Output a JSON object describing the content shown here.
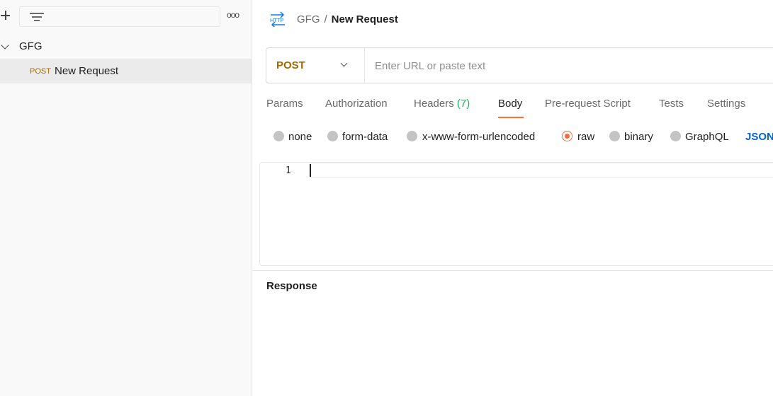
{
  "sidebar": {
    "filter_placeholder": "",
    "collection": {
      "name": "GFG"
    },
    "requests": [
      {
        "method": "POST",
        "name": "New Request"
      }
    ],
    "more_label": "ooo"
  },
  "header": {
    "icon": "http-icon",
    "breadcrumb_parent": "GFG",
    "breadcrumb_separator": "/",
    "breadcrumb_current": "New Request"
  },
  "url_bar": {
    "method": "POST",
    "placeholder": "Enter URL or paste text",
    "value": ""
  },
  "tabs": {
    "params": "Params",
    "authorization": "Authorization",
    "headers": "Headers",
    "headers_count": "(7)",
    "body": "Body",
    "prerequest": "Pre-request Script",
    "tests": "Tests",
    "settings": "Settings",
    "active": "Body"
  },
  "body_types": {
    "none": "none",
    "form_data": "form-data",
    "urlencoded": "x-www-form-urlencoded",
    "raw": "raw",
    "binary": "binary",
    "graphql": "GraphQL",
    "selected": "raw",
    "raw_format": "JSON"
  },
  "editor": {
    "line_number": "1",
    "content": ""
  },
  "response": {
    "label": "Response"
  },
  "colors": {
    "accent": "#ff6c37",
    "post_method": "#a56800",
    "headers_count": "#0cbb52",
    "json_link": "#0265d2"
  }
}
